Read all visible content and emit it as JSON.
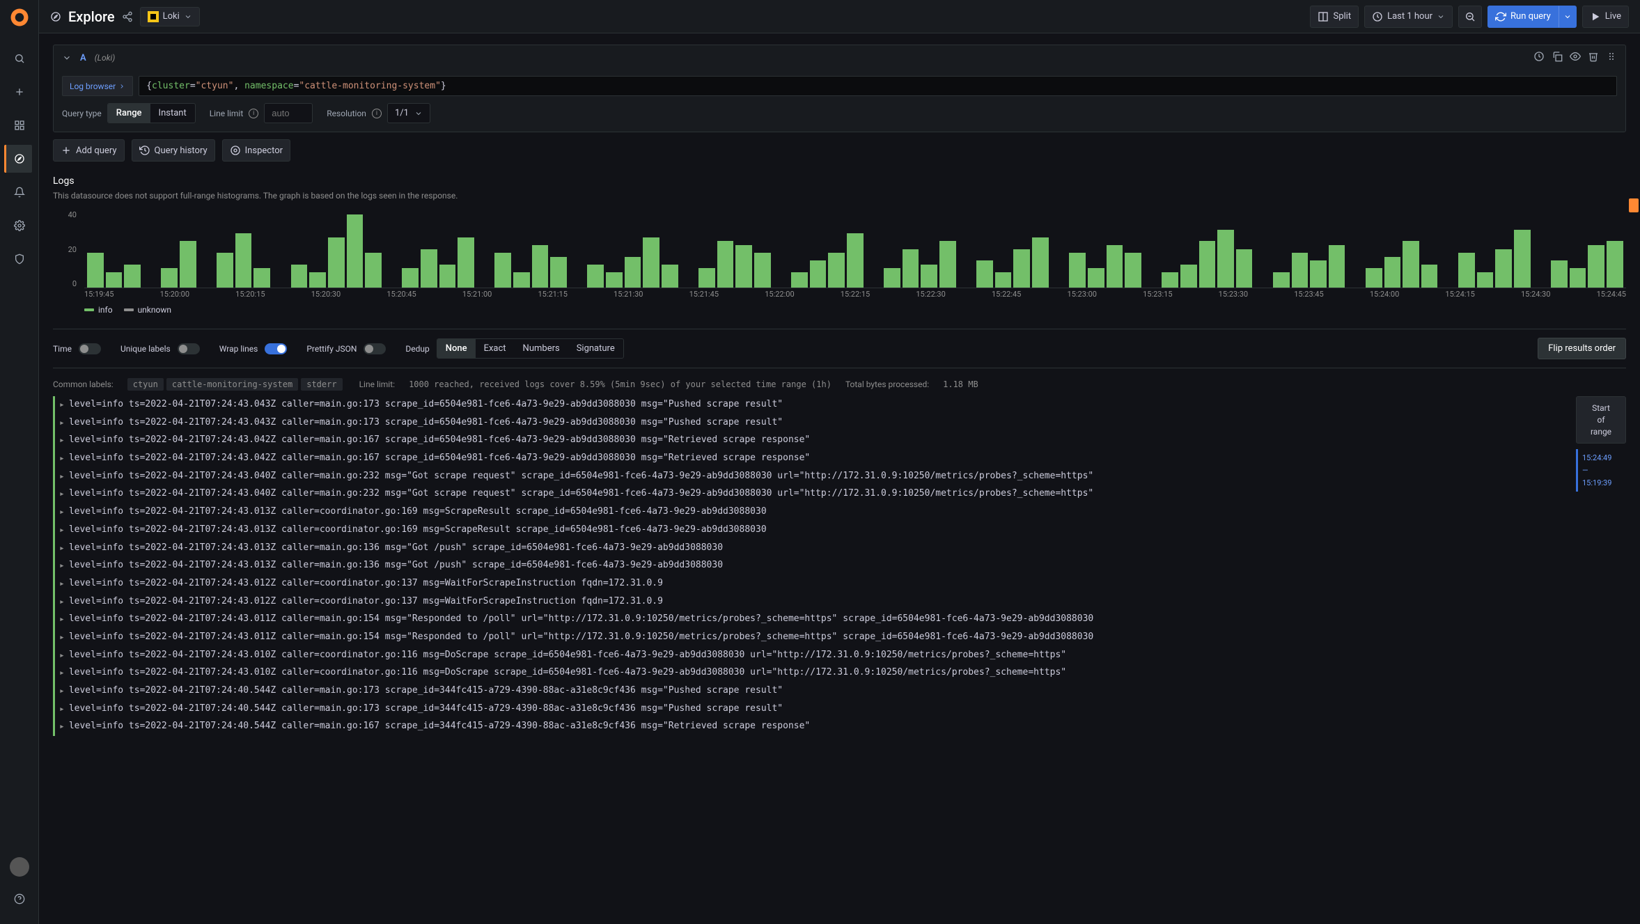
{
  "sidebar": {
    "items": [
      "search",
      "add",
      "dashboards",
      "explore",
      "alerts",
      "settings",
      "shield"
    ]
  },
  "topbar": {
    "title": "Explore",
    "datasource": "Loki",
    "split": "Split",
    "timerange": "Last 1 hour",
    "run_query": "Run query",
    "live": "Live"
  },
  "query": {
    "letter": "A",
    "ds_label": "(Loki)",
    "log_browser": "Log browser",
    "expr_key1": "cluster",
    "expr_val1": "ctyun",
    "expr_key2": "namespace",
    "expr_val2": "cattle-monitoring-system",
    "query_type_label": "Query type",
    "range": "Range",
    "instant": "Instant",
    "line_limit_label": "Line limit",
    "line_limit_placeholder": "auto",
    "resolution_label": "Resolution",
    "resolution_value": "1/1"
  },
  "toolbar": {
    "add_query": "Add query",
    "query_history": "Query history",
    "inspector": "Inspector"
  },
  "logs_section": {
    "title": "Logs",
    "subtitle": "This datasource does not support full-range histograms. The graph is based on the logs seen in the response."
  },
  "chart_data": {
    "type": "bar",
    "ylim": [
      0,
      40
    ],
    "yticks": [
      "40",
      "20",
      "0"
    ],
    "categories": [
      "15:19:45",
      "15:20:00",
      "15:20:15",
      "15:20:30",
      "15:20:45",
      "15:21:00",
      "15:21:15",
      "15:21:30",
      "15:21:45",
      "15:22:00",
      "15:22:15",
      "15:22:30",
      "15:22:45",
      "15:23:00",
      "15:23:15",
      "15:23:30",
      "15:23:45",
      "15:24:00",
      "15:24:15",
      "15:24:30",
      "15:24:45"
    ],
    "values": [
      18,
      8,
      12,
      0,
      10,
      24,
      0,
      18,
      28,
      10,
      0,
      12,
      8,
      26,
      38,
      18,
      0,
      10,
      20,
      12,
      26,
      0,
      18,
      8,
      22,
      16,
      0,
      12,
      8,
      16,
      26,
      12,
      0,
      10,
      24,
      22,
      18,
      0,
      8,
      14,
      18,
      28,
      0,
      10,
      20,
      12,
      24,
      0,
      14,
      8,
      20,
      26,
      0,
      18,
      10,
      22,
      18,
      0,
      8,
      12,
      24,
      30,
      20,
      0,
      8,
      18,
      14,
      22,
      0,
      10,
      16,
      24,
      12,
      0,
      18,
      8,
      20,
      30,
      0,
      14,
      10,
      22,
      24
    ],
    "legend": [
      {
        "name": "info",
        "color": "#73bf69"
      },
      {
        "name": "unknown",
        "color": "#8e8e8e"
      }
    ]
  },
  "controls": {
    "time": "Time",
    "unique_labels": "Unique labels",
    "wrap_lines": "Wrap lines",
    "prettify_json": "Prettify JSON",
    "dedup": "Dedup",
    "dedup_options": [
      "None",
      "Exact",
      "Numbers",
      "Signature"
    ],
    "flip": "Flip results order"
  },
  "meta": {
    "common_labels_label": "Common labels:",
    "common_labels": [
      "ctyun",
      "cattle-monitoring-system",
      "stderr"
    ],
    "line_limit_label": "Line limit:",
    "line_limit_text": "1000 reached, received logs cover 8.59% (5min 9sec) of your selected time range (1h)",
    "total_bytes_label": "Total bytes processed:",
    "total_bytes": "1.18 MB"
  },
  "range_sidebar": {
    "start_label": "Start\nof\nrange",
    "t1": "15:24:49",
    "dash": "—",
    "t2": "15:19:39"
  },
  "logs": [
    "level=info ts=2022-04-21T07:24:43.043Z caller=main.go:173 scrape_id=6504e981-fce6-4a73-9e29-ab9dd3088030 msg=\"Pushed scrape result\"",
    "level=info ts=2022-04-21T07:24:43.043Z caller=main.go:173 scrape_id=6504e981-fce6-4a73-9e29-ab9dd3088030 msg=\"Pushed scrape result\"",
    "level=info ts=2022-04-21T07:24:43.042Z caller=main.go:167 scrape_id=6504e981-fce6-4a73-9e29-ab9dd3088030 msg=\"Retrieved scrape response\"",
    "level=info ts=2022-04-21T07:24:43.042Z caller=main.go:167 scrape_id=6504e981-fce6-4a73-9e29-ab9dd3088030 msg=\"Retrieved scrape response\"",
    "level=info ts=2022-04-21T07:24:43.040Z caller=main.go:232 msg=\"Got scrape request\" scrape_id=6504e981-fce6-4a73-9e29-ab9dd3088030 url=\"http://172.31.0.9:10250/metrics/probes?_scheme=https\"",
    "level=info ts=2022-04-21T07:24:43.040Z caller=main.go:232 msg=\"Got scrape request\" scrape_id=6504e981-fce6-4a73-9e29-ab9dd3088030 url=\"http://172.31.0.9:10250/metrics/probes?_scheme=https\"",
    "level=info ts=2022-04-21T07:24:43.013Z caller=coordinator.go:169 msg=ScrapeResult scrape_id=6504e981-fce6-4a73-9e29-ab9dd3088030",
    "level=info ts=2022-04-21T07:24:43.013Z caller=coordinator.go:169 msg=ScrapeResult scrape_id=6504e981-fce6-4a73-9e29-ab9dd3088030",
    "level=info ts=2022-04-21T07:24:43.013Z caller=main.go:136 msg=\"Got /push\" scrape_id=6504e981-fce6-4a73-9e29-ab9dd3088030",
    "level=info ts=2022-04-21T07:24:43.013Z caller=main.go:136 msg=\"Got /push\" scrape_id=6504e981-fce6-4a73-9e29-ab9dd3088030",
    "level=info ts=2022-04-21T07:24:43.012Z caller=coordinator.go:137 msg=WaitForScrapeInstruction fqdn=172.31.0.9",
    "level=info ts=2022-04-21T07:24:43.012Z caller=coordinator.go:137 msg=WaitForScrapeInstruction fqdn=172.31.0.9",
    "level=info ts=2022-04-21T07:24:43.011Z caller=main.go:154 msg=\"Responded to /poll\" url=\"http://172.31.0.9:10250/metrics/probes?_scheme=https\" scrape_id=6504e981-fce6-4a73-9e29-ab9dd3088030",
    "level=info ts=2022-04-21T07:24:43.011Z caller=main.go:154 msg=\"Responded to /poll\" url=\"http://172.31.0.9:10250/metrics/probes?_scheme=https\" scrape_id=6504e981-fce6-4a73-9e29-ab9dd3088030",
    "level=info ts=2022-04-21T07:24:43.010Z caller=coordinator.go:116 msg=DoScrape scrape_id=6504e981-fce6-4a73-9e29-ab9dd3088030 url=\"http://172.31.0.9:10250/metrics/probes?_scheme=https\"",
    "level=info ts=2022-04-21T07:24:43.010Z caller=coordinator.go:116 msg=DoScrape scrape_id=6504e981-fce6-4a73-9e29-ab9dd3088030 url=\"http://172.31.0.9:10250/metrics/probes?_scheme=https\"",
    "level=info ts=2022-04-21T07:24:40.544Z caller=main.go:173 scrape_id=344fc415-a729-4390-88ac-a31e8c9cf436 msg=\"Pushed scrape result\"",
    "level=info ts=2022-04-21T07:24:40.544Z caller=main.go:173 scrape_id=344fc415-a729-4390-88ac-a31e8c9cf436 msg=\"Pushed scrape result\"",
    "level=info ts=2022-04-21T07:24:40.544Z caller=main.go:167 scrape_id=344fc415-a729-4390-88ac-a31e8c9cf436 msg=\"Retrieved scrape response\""
  ]
}
